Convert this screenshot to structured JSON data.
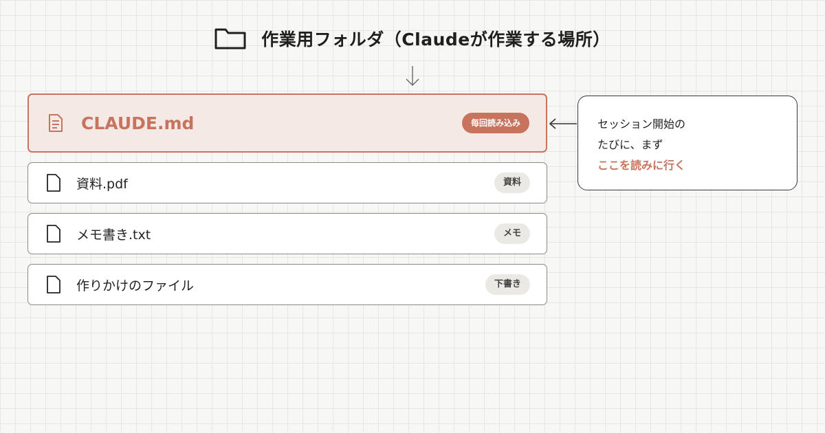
{
  "header": {
    "icon": "folder-icon",
    "title": "作業用フォルダ（Claudeが作業する場所）"
  },
  "files": [
    {
      "name": "CLAUDE.md",
      "tag": "毎回読み込み",
      "icon": "document-lines-icon",
      "primary": true
    },
    {
      "name": "資料.pdf",
      "tag": "資料",
      "icon": "file-icon"
    },
    {
      "name": "メモ書き.txt",
      "tag": "メモ",
      "icon": "file-icon"
    },
    {
      "name": "作りかけのファイル",
      "tag": "下書き",
      "icon": "file-icon"
    }
  ],
  "note": {
    "lines": [
      "セッション開始の",
      "たびに、まず",
      "ここを読みに行く"
    ]
  },
  "colors": {
    "accent": "#c8735e",
    "accent_bg": "#f5e9e5",
    "tag_bg": "#ebe9e3",
    "text": "#222222",
    "grid_bg": "#f7f7f5"
  }
}
